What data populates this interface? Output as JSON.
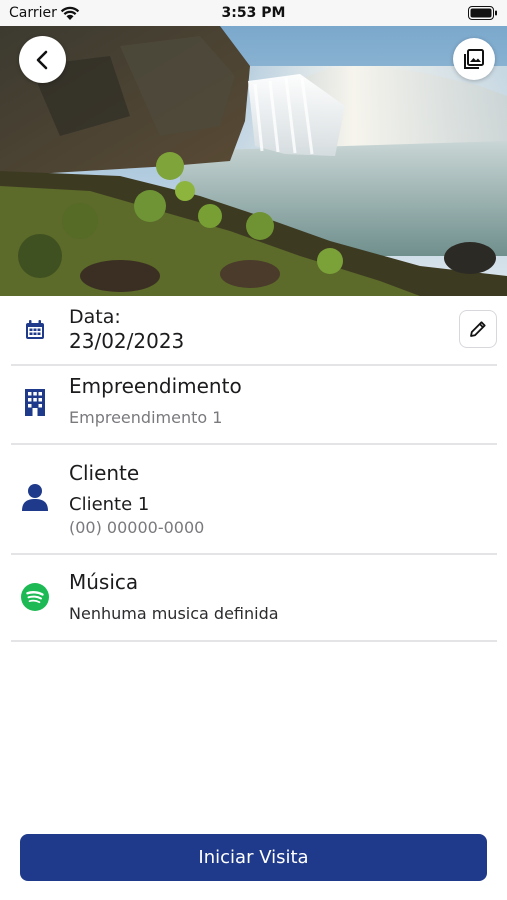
{
  "status_bar": {
    "carrier": "Carrier",
    "time": "3:53 PM"
  },
  "hero": {
    "back_icon": "chevron-left-icon",
    "gallery_icon": "photo-library-icon"
  },
  "details": {
    "date": {
      "icon": "calendar-icon",
      "label": "Data:",
      "value": "23/02/2023",
      "edit_icon": "pencil-icon"
    },
    "empreendimento": {
      "icon": "building-icon",
      "label": "Empreendimento",
      "value": "Empreendimento 1"
    },
    "cliente": {
      "icon": "person-icon",
      "label": "Cliente",
      "name": "Cliente 1",
      "phone": "(00) 00000-0000"
    },
    "musica": {
      "icon": "spotify-icon",
      "label": "Música",
      "value": "Nenhuma musica definida"
    }
  },
  "actions": {
    "start_visit_label": "Iniciar Visita"
  },
  "colors": {
    "primary": "#1f3a8a",
    "icon_blue": "#1f3a8a",
    "spotify_green": "#1db954",
    "muted_text": "#7a7a7e",
    "divider": "#e4e4e6"
  }
}
